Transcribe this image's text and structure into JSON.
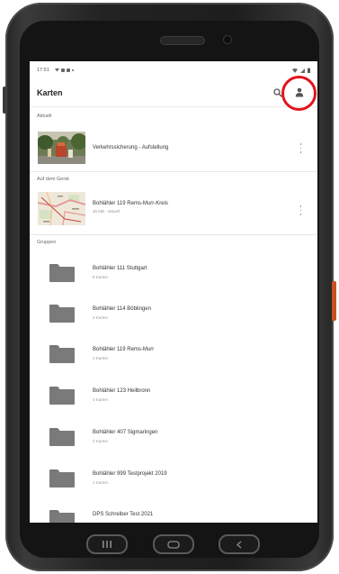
{
  "status_bar": {
    "time": "17:51",
    "left_icons": [
      "download-icon",
      "notification-icon",
      "notification-icon",
      "dot-icon"
    ],
    "right_icons": [
      "wifi-icon",
      "signal-icon",
      "battery-icon"
    ]
  },
  "app_bar": {
    "title": "Karten",
    "search_icon": "search-icon",
    "account_icon": "person-icon"
  },
  "sections": {
    "recent": "Aktuell",
    "on_device": "Auf dem Gerät",
    "groups": "Gruppen"
  },
  "recent_items": [
    {
      "title": "Verkehrssicherung - Aufstellung",
      "thumbnail": "photo-thumbnail",
      "menu_icon": "kebab-menu-icon"
    }
  ],
  "device_items": [
    {
      "title": "Bohlähler 119 Rems-Murr-Kreis",
      "subtitle": "30 MB - aktuell",
      "thumbnail": "map-thumbnail",
      "menu_icon": "kebab-menu-icon"
    }
  ],
  "groups": [
    {
      "title": "Bohlähler 111 Stuttgart",
      "subtitle": "8 Karten",
      "icon": "folder-icon"
    },
    {
      "title": "Bohlähler 114 Böblingen",
      "subtitle": "3 Karten",
      "icon": "folder-icon"
    },
    {
      "title": "Bohlähler 119 Rems-Murr",
      "subtitle": "2 Karten",
      "icon": "folder-icon"
    },
    {
      "title": "Bohlähler 123 Heilbronn",
      "subtitle": "4 Karten",
      "icon": "folder-icon"
    },
    {
      "title": "Bohlähler 407 Sigmaringen",
      "subtitle": "2 Karten",
      "icon": "folder-icon"
    },
    {
      "title": "Bohlähler 999 Testprojekt 2019",
      "subtitle": "1 Karten",
      "icon": "folder-icon"
    },
    {
      "title": "DPS Schreiber Test 2021",
      "icon": "folder-icon"
    }
  ],
  "hardware_keys": [
    "recent-apps-icon",
    "home-icon",
    "back-icon"
  ],
  "highlight": {
    "color": "#e3131b",
    "target": "person-icon"
  },
  "colors": {
    "device_frame": "#262626",
    "folder": "#7a7a7a",
    "side_button": "#c9521e"
  }
}
